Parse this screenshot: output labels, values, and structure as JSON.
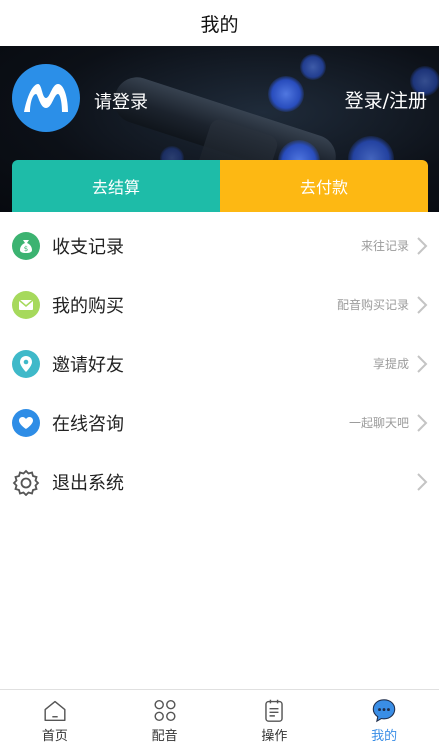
{
  "header": {
    "title": "我的"
  },
  "profile": {
    "login_prompt": "请登录",
    "login_register": "登录/注册",
    "avatar_letter": "M"
  },
  "actions": {
    "settle": "去结算",
    "pay": "去付款"
  },
  "menu": [
    {
      "label": "收支记录",
      "hint": "来往记录",
      "icon": "money-bag-icon",
      "color": "#3cb371"
    },
    {
      "label": "我的购买",
      "hint": "配音购买记录",
      "icon": "mail-icon",
      "color": "#a6d95c"
    },
    {
      "label": "邀请好友",
      "hint": "享提成",
      "icon": "location-pin-icon",
      "color": "#3fb9c9"
    },
    {
      "label": "在线咨询",
      "hint": "一起聊天吧",
      "icon": "heart-icon",
      "color": "#2e8de6"
    },
    {
      "label": "退出系统",
      "hint": "",
      "icon": "gear-icon",
      "color": "#555555"
    }
  ],
  "tabs": [
    {
      "label": "首页",
      "icon": "home-icon",
      "active": false
    },
    {
      "label": "配音",
      "icon": "grid-icon",
      "active": false
    },
    {
      "label": "操作",
      "icon": "clipboard-icon",
      "active": false
    },
    {
      "label": "我的",
      "icon": "chat-bubble-icon",
      "active": true
    }
  ]
}
